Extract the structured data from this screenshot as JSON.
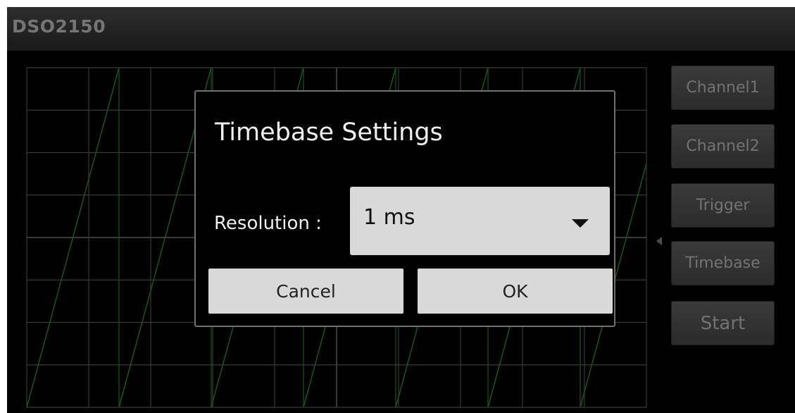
{
  "app": {
    "title": "DSO2150"
  },
  "sidebar": {
    "buttons": [
      {
        "label": "Channel1"
      },
      {
        "label": "Channel2"
      },
      {
        "label": "Trigger"
      },
      {
        "label": "Timebase"
      },
      {
        "label": "Start"
      }
    ]
  },
  "dialog": {
    "title": "Timebase Settings",
    "resolution_label": "Resolution :",
    "resolution_value": "1 ms",
    "cancel_label": "Cancel",
    "ok_label": "OK"
  },
  "colors": {
    "grid": "#6a6a6a",
    "trace": "#1f9b2a",
    "background": "#000000"
  },
  "icons": {
    "marker": "trigger-marker-icon",
    "dropdown": "chevron-down-icon"
  }
}
